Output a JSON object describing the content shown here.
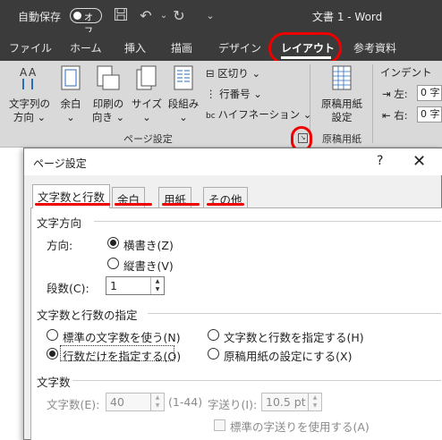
{
  "window": {
    "autosave_label": "自動保存",
    "autosave_state": "オフ",
    "doc_title": "文書 1  -  Word"
  },
  "tabs": [
    "ファイル",
    "ホーム",
    "挿入",
    "描画",
    "デザイン",
    "レイアウト",
    "参考資料"
  ],
  "active_tab": "レイアウト",
  "ribbon": {
    "text_direction": [
      "文字列の",
      "方向 ⌄"
    ],
    "margins": [
      "余白",
      "⌄"
    ],
    "orientation": [
      "印刷の",
      "向き ⌄"
    ],
    "size": [
      "サイズ",
      "⌄"
    ],
    "columns": [
      "段組み",
      "⌄"
    ],
    "breaks": "区切り ⌄",
    "line_numbers": "行番号 ⌄",
    "hyphenation": "ハイフネーション ⌄",
    "page_setup_group": "ページ設定",
    "manuscript": [
      "原稿用紙",
      "設定"
    ],
    "manuscript_group": "原稿用紙",
    "indent_label": "インデント",
    "indent_left": "左:",
    "indent_right": "右:",
    "indent_value": "0 字"
  },
  "dialog": {
    "title": "ページ設定",
    "help": "?",
    "close": "✕",
    "tabs": [
      "文字数と行数",
      "余白",
      "用紙",
      "その他"
    ],
    "section_direction": "文字方向",
    "direction_label": "方向:",
    "horizontal": "横書き(Z)",
    "vertical": "縦書き(V)",
    "columns_label": "段数(C):",
    "columns_value": "1",
    "section_grid": "文字数と行数の指定",
    "grid_options": [
      "標準の文字数を使う(N)",
      "文字数と行数を指定する(H)",
      "行数だけを指定する(O)",
      "原稿用紙の設定にする(X)"
    ],
    "section_chars": "文字数",
    "chars_label": "文字数(E):",
    "chars_value": "40",
    "chars_range": "(1-44)",
    "pitch_label": "字送り(I):",
    "pitch_value": "10.5 pt",
    "std_pitch": "標準の字送りを使用する(A)"
  },
  "colors": {
    "annotation": "#e00000",
    "title_bar": "#3b3b3b",
    "ribbon": "#d9d9d9"
  }
}
